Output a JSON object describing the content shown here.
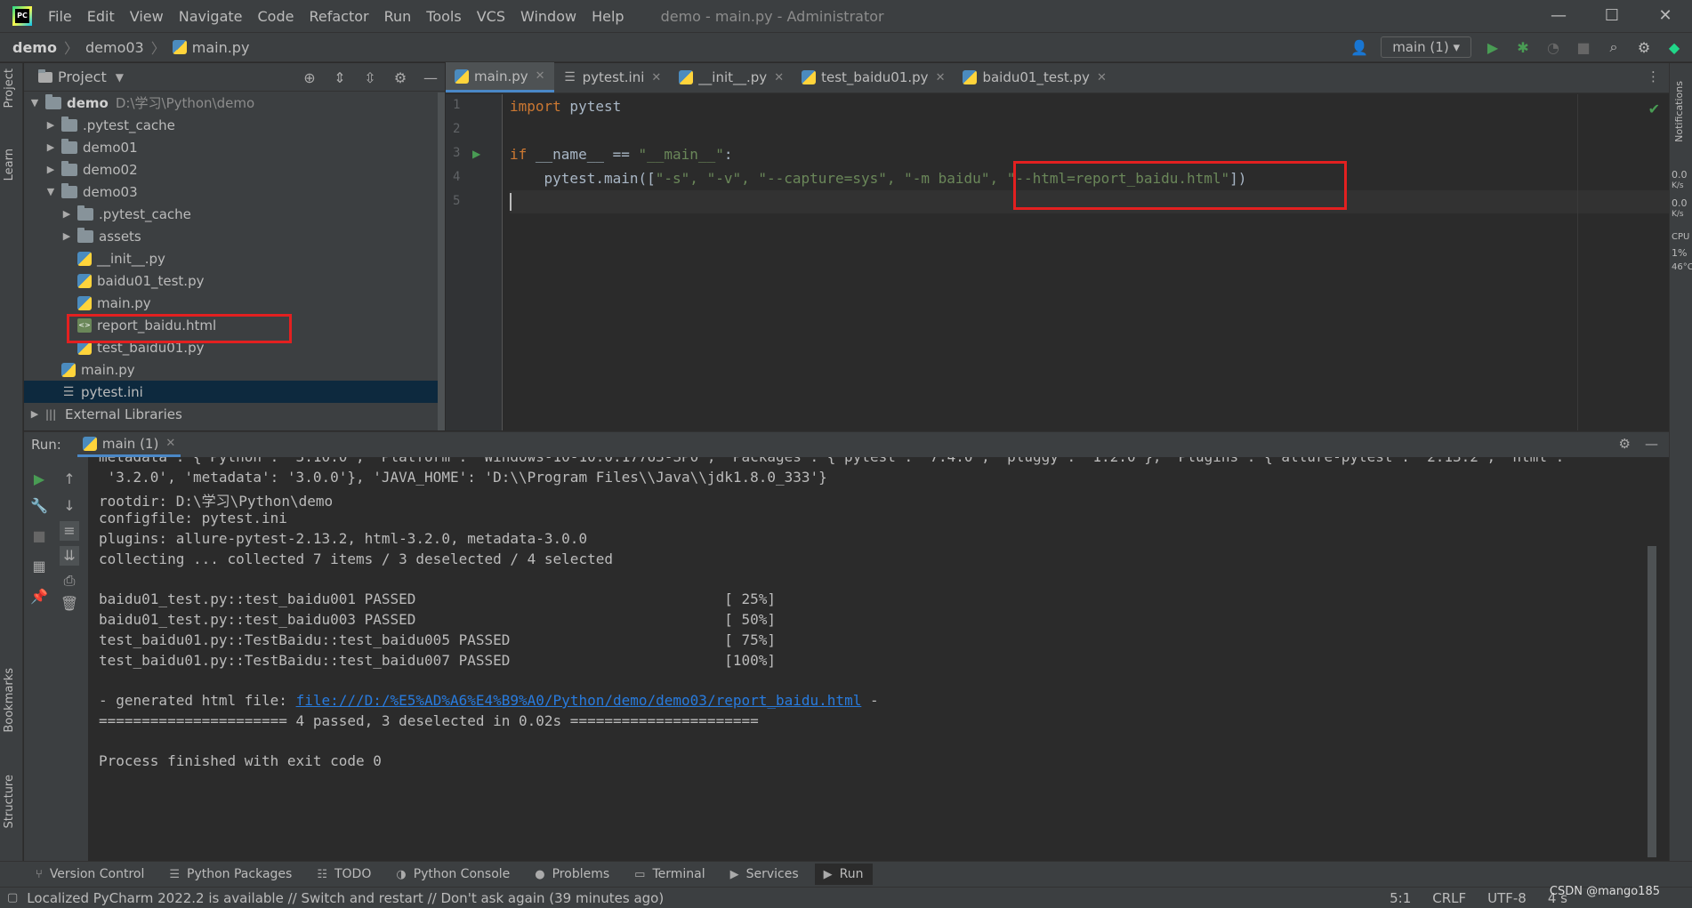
{
  "titlebar": {
    "menu": [
      "File",
      "Edit",
      "View",
      "Navigate",
      "Code",
      "Refactor",
      "Run",
      "Tools",
      "VCS",
      "Window",
      "Help"
    ],
    "title": "demo - main.py - Administrator",
    "controls": {
      "minimize": "—",
      "maximize": "☐",
      "close": "✕"
    }
  },
  "breadcrumb": [
    "demo",
    "demo03",
    "main.py"
  ],
  "navbar": {
    "run_config": "main (1)"
  },
  "project": {
    "title": "Project",
    "tree": [
      {
        "label": "demo",
        "path": "D:\\学习\\Python\\demo"
      },
      {
        "label": ".pytest_cache"
      },
      {
        "label": "demo01"
      },
      {
        "label": "demo02"
      },
      {
        "label": "demo03"
      },
      {
        "label": ".pytest_cache"
      },
      {
        "label": "assets"
      },
      {
        "label": "__init__.py"
      },
      {
        "label": "baidu01_test.py"
      },
      {
        "label": "main.py"
      },
      {
        "label": "report_baidu.html"
      },
      {
        "label": "test_baidu01.py"
      },
      {
        "label": "main.py"
      },
      {
        "label": "pytest.ini"
      },
      {
        "label": "External Libraries"
      }
    ]
  },
  "editor": {
    "tabs": [
      "main.py",
      "pytest.ini",
      "__init__.py",
      "test_baidu01.py",
      "baidu01_test.py"
    ],
    "line_numbers": [
      "1",
      "2",
      "3",
      "4",
      "5"
    ],
    "code": {
      "l1_kw": "import",
      "l1_rest": " pytest",
      "l3_kw": "if",
      "l3_name": " __name__ == ",
      "l3_str": "\"__main__\"",
      "l3_end": ":",
      "l4_start": "    pytest.main([",
      "l4_args": "\"-s\", \"-v\", \"--capture=sys\", \"-m baidu\", ",
      "l4_html": "\"--html=report_baidu.html\"",
      "l4_end": "])"
    }
  },
  "run": {
    "label": "Run:",
    "tab": "main (1)",
    "console": [
      "metadata': {'Python': '3.10.0', 'Platform': 'Windows-10-10.0.17763-SP0', 'Packages': {'pytest': '7.4.0', 'pluggy': '1.2.0'}, 'Plugins': {'allure-pytest': '2.13.2', 'html':",
      " '3.2.0', 'metadata': '3.0.0'}, 'JAVA_HOME': 'D:\\\\Program Files\\\\Java\\\\jdk1.8.0_333'}",
      "rootdir: D:\\学习\\Python\\demo",
      "configfile: pytest.ini",
      "plugins: allure-pytest-2.13.2, html-3.2.0, metadata-3.0.0",
      "collecting ... collected 7 items / 3 deselected / 4 selected",
      "",
      "baidu01_test.py::test_baidu001 PASSED                                    [ 25%]",
      "baidu01_test.py::test_baidu003 PASSED                                    [ 50%]",
      "test_baidu01.py::TestBaidu::test_baidu005 PASSED                         [ 75%]",
      "test_baidu01.py::TestBaidu::test_baidu007 PASSED                         [100%]",
      "",
      "",
      "====================== 4 passed, 3 deselected in 0.02s ======================",
      "",
      "Process finished with exit code 0"
    ],
    "generated_prefix": "- generated html file: ",
    "generated_link": "file:///D:/%E5%AD%A6%E4%B9%A0/Python/demo/demo03/report_baidu.html",
    "generated_suffix": " -"
  },
  "bottom_tools": [
    "Version Control",
    "Python Packages",
    "TODO",
    "Python Console",
    "Problems",
    "Terminal",
    "Services",
    "Run"
  ],
  "status": {
    "message": "Localized PyCharm 2022.2 is available // Switch and restart // Don't ask again (39 minutes ago)",
    "position": "5:1",
    "line_sep": "CRLF",
    "encoding": "UTF-8",
    "indent": "4 s"
  },
  "left_stripe": [
    "Project",
    "Learn",
    "Bookmarks",
    "Structure"
  ],
  "right_stripe": {
    "notifications": "Notifications",
    "net1": "0.0",
    "net1u": "K/s",
    "net2": "0.0",
    "net2u": "K/s",
    "cpu": "CPU",
    "cpu_val": "1%",
    "temp": "46°C"
  },
  "watermark": "CSDN @mango185"
}
